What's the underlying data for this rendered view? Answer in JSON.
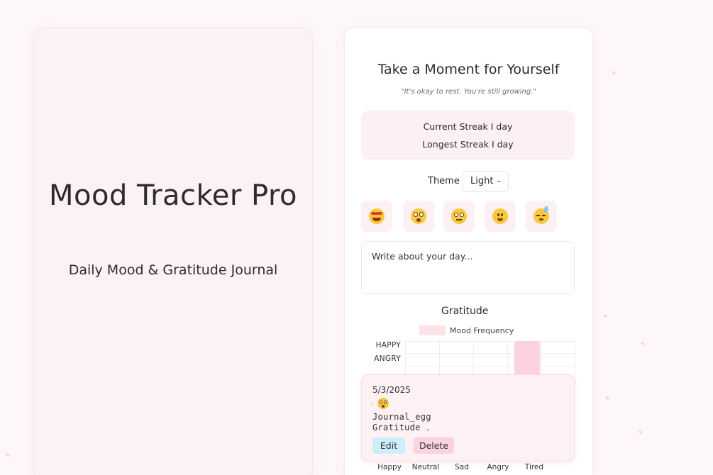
{
  "hero": {
    "title": "Mood Tracker Pro",
    "subtitle": "Daily Mood & Gratitude Journal"
  },
  "card": {
    "title": "Take a Moment for Yourself",
    "quote": "\"It's okay to rest. You're still growing.\"",
    "streak": {
      "current": "Current Streak I day",
      "longest": "Longest Streak I day"
    },
    "theme": {
      "label": "Theme",
      "value": "Light"
    },
    "moods": [
      {
        "name": "happy",
        "icon": "happy-face-icon"
      },
      {
        "name": "neutral",
        "icon": "surprised-face-icon"
      },
      {
        "name": "sad",
        "icon": "worried-face-icon"
      },
      {
        "name": "angry",
        "icon": "smiling-face-icon"
      },
      {
        "name": "tired",
        "icon": "sleepy-face-icon"
      }
    ],
    "journal_placeholder": "Write about your day...",
    "gratitude_label": "Gratitude"
  },
  "chart_data": {
    "type": "bar",
    "title": "",
    "legend": [
      "Mood Frequency"
    ],
    "categories": [
      "Happy",
      "Neutral",
      "Sad",
      "Angry",
      "Tired"
    ],
    "y_labels": [
      "HAPPY",
      "ANGRY"
    ],
    "series": [
      {
        "name": "Mood Frequency",
        "values": [
          0,
          0,
          0,
          1,
          0
        ]
      }
    ],
    "colors": {
      "bar": "#fdd2e0"
    }
  },
  "entry": {
    "date": "5/3/2025",
    "icon": "surprised-face-icon",
    "journal": "Journal_egg",
    "gratitude": "Gratitude",
    "edit_label": "Edit",
    "delete_label": "Delete"
  },
  "colors": {
    "background": "#fdf7f9",
    "accent_pink": "#fdd2e0",
    "edit_blue": "#cdeefb"
  }
}
